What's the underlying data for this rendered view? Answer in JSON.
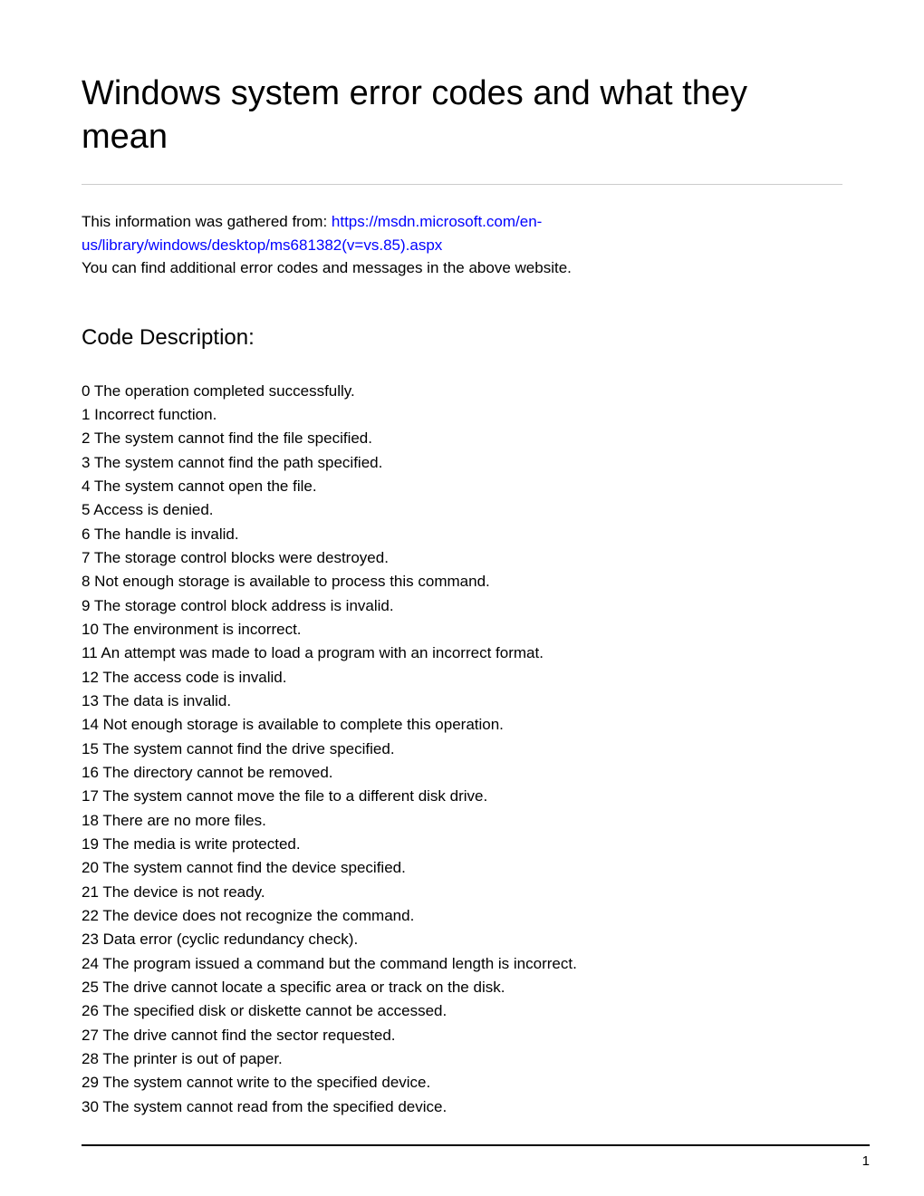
{
  "title": "Windows system error codes and what they mean",
  "intro": {
    "prefix": "This information was gathered from: ",
    "link_text": "https://msdn.microsoft.com/en-us/library/windows/desktop/ms681382(v=vs.85).aspx",
    "suffix_line": "You can find additional error codes and messages in the above website."
  },
  "section_heading": "Code Description:",
  "codes": [
    {
      "code": "0",
      "desc": "The operation completed successfully."
    },
    {
      "code": "1",
      "desc": "Incorrect function."
    },
    {
      "code": "2",
      "desc": "The system cannot find the file specified."
    },
    {
      "code": "3",
      "desc": "The system cannot find the path specified."
    },
    {
      "code": "4",
      "desc": "The system cannot open the file."
    },
    {
      "code": "5",
      "desc": "Access is denied."
    },
    {
      "code": "6",
      "desc": "The handle is invalid."
    },
    {
      "code": "7",
      "desc": "The storage control blocks were destroyed."
    },
    {
      "code": "8",
      "desc": "Not enough storage is available to process this command."
    },
    {
      "code": "9",
      "desc": "The storage control block address is invalid."
    },
    {
      "code": "10",
      "desc": "The environment is incorrect."
    },
    {
      "code": "11",
      "desc": "An attempt was made to load a program with an incorrect format."
    },
    {
      "code": "12",
      "desc": "The access code is invalid."
    },
    {
      "code": "13",
      "desc": "The data is invalid."
    },
    {
      "code": "14",
      "desc": "Not enough storage is available to complete this operation."
    },
    {
      "code": "15",
      "desc": "The system cannot find the drive specified."
    },
    {
      "code": "16",
      "desc": "The directory cannot be removed."
    },
    {
      "code": "17",
      "desc": "The system cannot move the file to a different disk drive."
    },
    {
      "code": "18",
      "desc": "There are no more files."
    },
    {
      "code": "19",
      "desc": "The media is write protected."
    },
    {
      "code": "20",
      "desc": "The system cannot find the device specified."
    },
    {
      "code": "21",
      "desc": "The device is not ready."
    },
    {
      "code": "22",
      "desc": "The device does not recognize the command."
    },
    {
      "code": "23",
      "desc": "Data error (cyclic redundancy check)."
    },
    {
      "code": "24",
      "desc": "The program issued a command but the command length is incorrect."
    },
    {
      "code": "25",
      "desc": "The drive cannot locate a specific area or track on the disk."
    },
    {
      "code": "26",
      "desc": "The specified disk or diskette cannot be accessed."
    },
    {
      "code": "27",
      "desc": "The drive cannot find the sector requested."
    },
    {
      "code": "28",
      "desc": "The printer is out of paper."
    },
    {
      "code": "29",
      "desc": "The system cannot write to the specified device."
    },
    {
      "code": "30",
      "desc": "The system cannot read from the specified device."
    }
  ],
  "page_number": "1"
}
